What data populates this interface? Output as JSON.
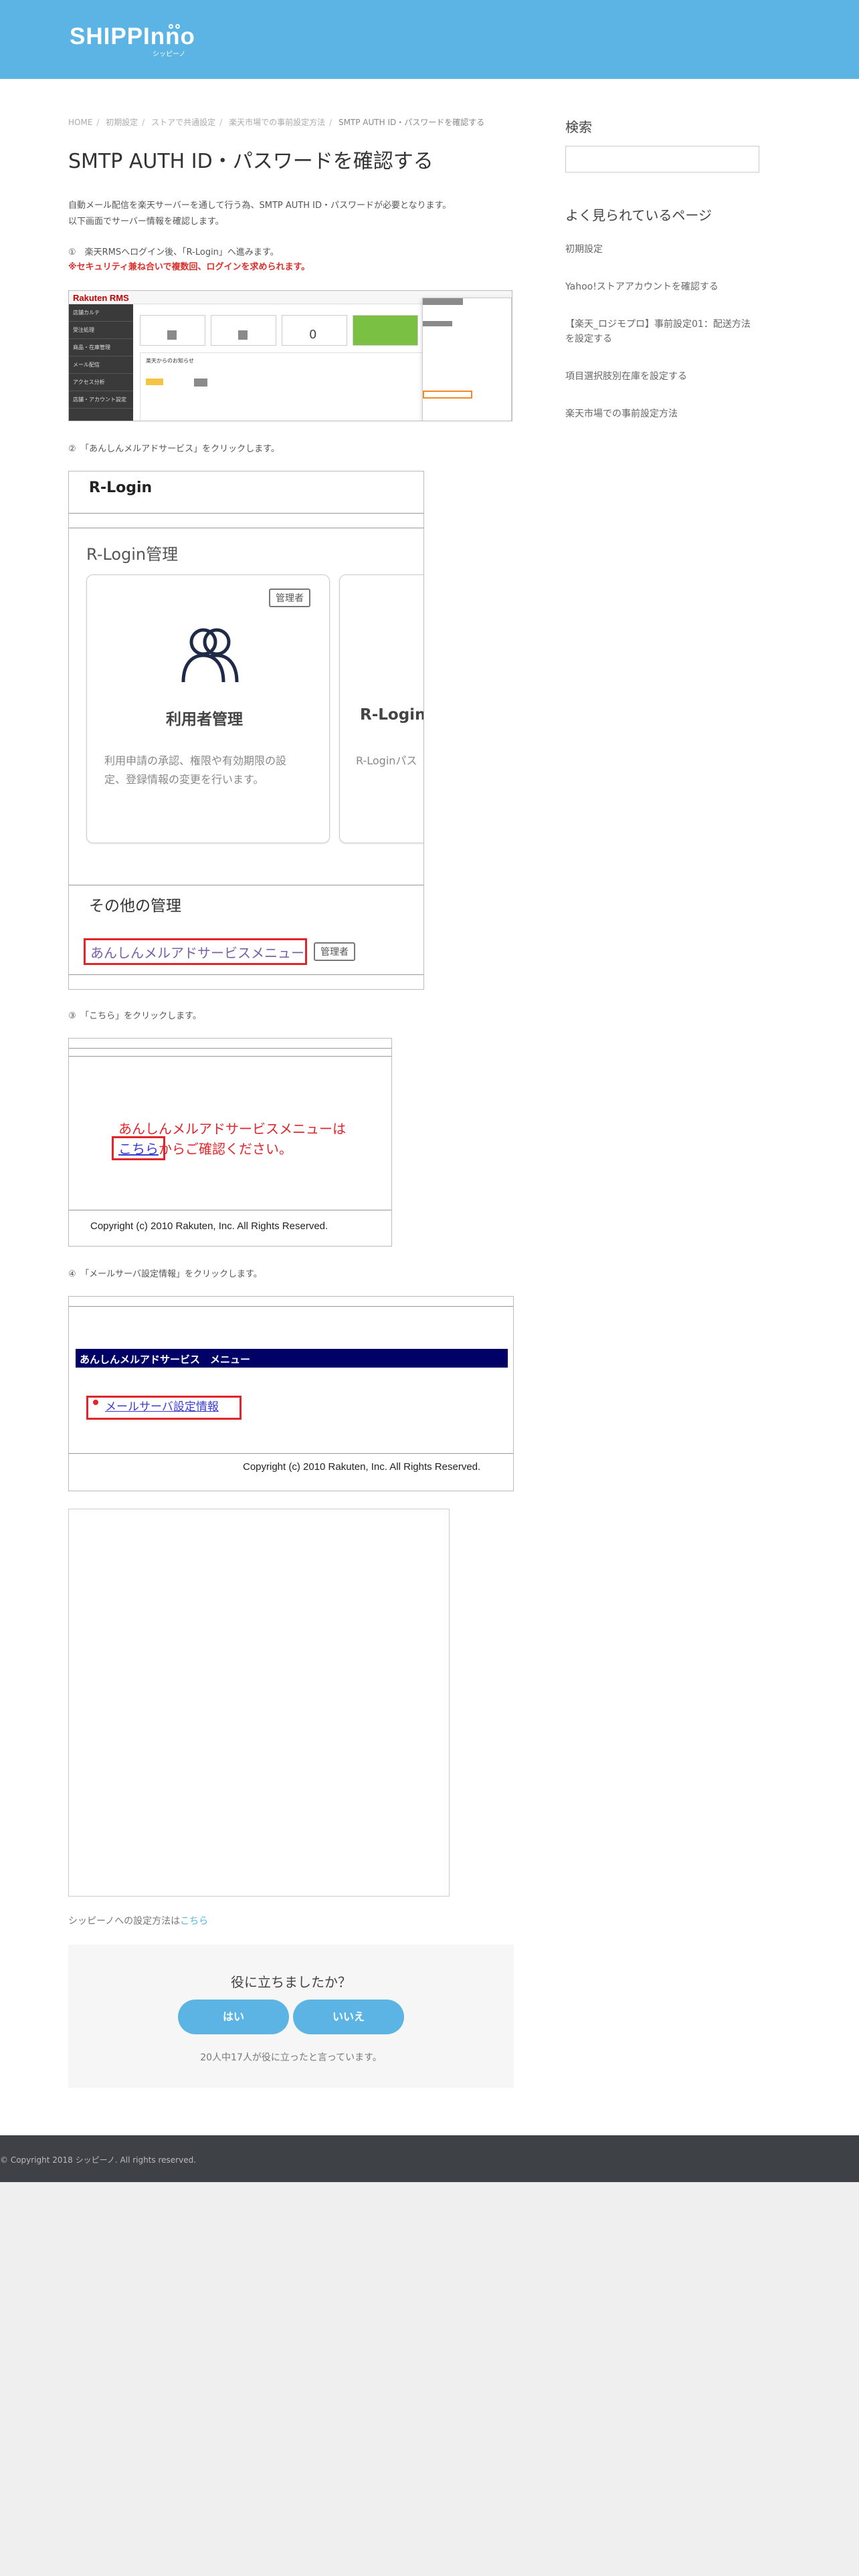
{
  "brand": {
    "name": "SHIPPInno",
    "sub": "シッピーノ"
  },
  "breadcrumb": [
    "HOME",
    "初期設定",
    "ストアで共通設定",
    "楽天市場での事前設定方法",
    "SMTP AUTH ID・パスワードを確認する"
  ],
  "page_title": "SMTP AUTH ID・パスワードを確認する",
  "intro": {
    "line1": "自動メール配信を楽天サーバーを通して行う為、SMTP AUTH ID・パスワードが必要となります。",
    "line2": "以下画面でサーバー情報を確認します。"
  },
  "steps": {
    "s1": "①　楽天RMSへログイン後、「R-Login」へ進みます。",
    "s1_warning": "※セキュリティ兼ね合いで複数回、ログインを求められます。",
    "s2": "②　「あんしんメルアドサービス」をクリックします。",
    "s3": "③　「こちら」をクリックします。",
    "s4": "④　「メールサーバ設定情報」をクリックします。"
  },
  "rms": {
    "logo": "Rakuten RMS",
    "menu": [
      "店舗カルテ",
      "受注処理",
      "商品・在庫管理",
      "メール配信",
      "アクセス分析",
      "店舗・アカウント設定"
    ],
    "panel_label": "楽天からのお知らせ",
    "counter": "0"
  },
  "rlogin": {
    "title": "R-Login",
    "section": "R-Login管理",
    "card1": {
      "badge": "管理者",
      "title": "利用者管理",
      "desc1": "利用申請の承認、権限や有効期限の設",
      "desc2": "定、登録情報の変更を行います。"
    },
    "card2": {
      "title": "R-Login",
      "desc": "R-Loginパス"
    },
    "other": "その他の管理",
    "anshin_link": "あんしんメルアドサービスメニュー",
    "admin_badge": "管理者"
  },
  "anshin_page": {
    "line1": "あんしんメルアドサービスメニューは",
    "link": "こちら",
    "line2_rest": "からご確認ください。",
    "copyright": "Copyright (c) 2010 Rakuten, Inc. All Rights Reserved."
  },
  "menu_page": {
    "title": "あんしんメルアドサービス　メニュー",
    "link": "メールサーバ設定情報",
    "copyright": "Copyright (c) 2010 Rakuten, Inc. All Rights Reserved."
  },
  "after": {
    "text": "シッピーノへの設定方法は",
    "link": "こちら"
  },
  "feedback": {
    "question": "役に立ちましたか？",
    "yes": "はい",
    "no": "いいえ",
    "count": "20人中17人が役に立ったと言っています。"
  },
  "sidebar": {
    "search_heading": "検索",
    "search_placeholder": "",
    "popular_heading": "よく見られているページ",
    "links": [
      "初期設定",
      "Yahoo!ストアアカウントを確認する",
      "【楽天_ロジモプロ】事前設定01：配送方法を設定する",
      "項目選択肢別在庫を設定する",
      "楽天市場での事前設定方法"
    ]
  },
  "footer": {
    "copyright": "© Copyright 2018 シッピーノ. All rights reserved."
  },
  "colors": {
    "brand": "#5bb4e3",
    "footer": "#3e4246",
    "highlight": "#e2242b",
    "navy": "#000066"
  }
}
